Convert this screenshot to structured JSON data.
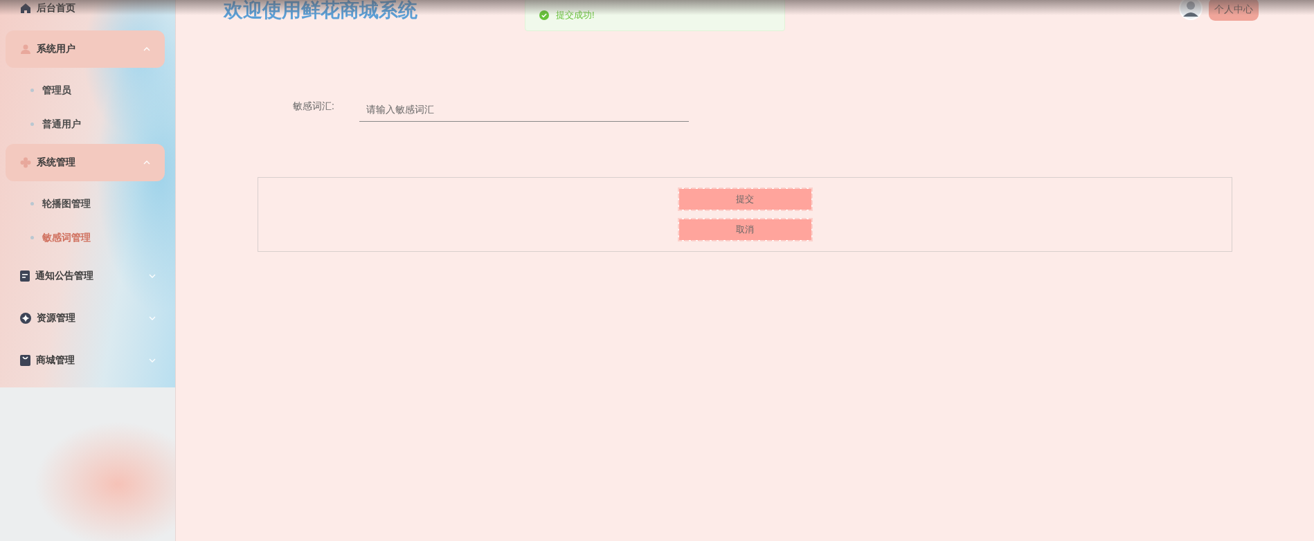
{
  "sidebar": {
    "items": [
      {
        "label": "后台首页",
        "kind": "link"
      },
      {
        "label": "系统用户",
        "kind": "group",
        "expanded": true,
        "children": [
          {
            "label": "管理员",
            "selected": false
          },
          {
            "label": "普通用户",
            "selected": false
          }
        ]
      },
      {
        "label": "系统管理",
        "kind": "group",
        "expanded": true,
        "children": [
          {
            "label": "轮播图管理",
            "selected": false
          },
          {
            "label": "敏感词管理",
            "selected": true
          }
        ]
      },
      {
        "label": "通知公告管理",
        "kind": "group",
        "expanded": false
      },
      {
        "label": "资源管理",
        "kind": "group",
        "expanded": false
      },
      {
        "label": "商城管理",
        "kind": "group",
        "expanded": false
      }
    ]
  },
  "header": {
    "title": "欢迎使用鲜花商城系统",
    "profile_button": "个人中心"
  },
  "toast": {
    "kind": "success",
    "message": "提交成功!"
  },
  "form": {
    "fields": [
      {
        "label": "敏感词汇:",
        "placeholder": "请输入敏感词汇"
      }
    ],
    "buttons": [
      "提交",
      "取消"
    ]
  }
}
